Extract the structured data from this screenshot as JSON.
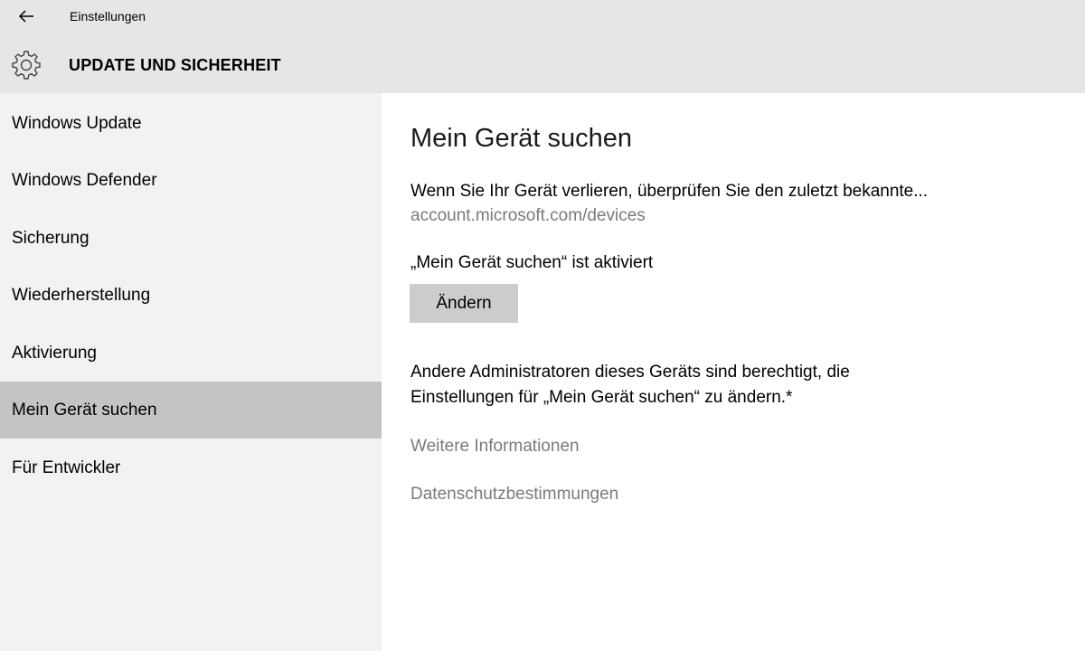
{
  "titlebar": {
    "back_icon": "back-arrow-icon",
    "title": "Einstellungen"
  },
  "header": {
    "icon": "gear-icon",
    "title": "UPDATE UND SICHERHEIT"
  },
  "sidebar": {
    "items": [
      {
        "label": "Windows Update"
      },
      {
        "label": "Windows Defender"
      },
      {
        "label": "Sicherung"
      },
      {
        "label": "Wiederherstellung"
      },
      {
        "label": "Aktivierung"
      },
      {
        "label": "Mein Gerät suchen",
        "selected": true
      },
      {
        "label": "Für Entwickler"
      }
    ]
  },
  "content": {
    "title": "Mein Gerät suchen",
    "description": "Wenn Sie Ihr Gerät verlieren, überprüfen Sie den zuletzt bekannte...",
    "devices_link": "account.microsoft.com/devices",
    "status": "„Mein Gerät suchen“ ist aktiviert",
    "change_button": "Ändern",
    "info_line1": "Andere Administratoren dieses Geräts sind berechtigt, die",
    "info_line2": "Einstellungen für „Mein Gerät suchen“ zu ändern.*",
    "more_info_link": "Weitere Informationen",
    "privacy_link": "Datenschutzbestimmungen"
  },
  "colors": {
    "header_bg": "#e6e6e6",
    "sidebar_bg": "#f2f2f2",
    "selected_bg": "#c4c4c4",
    "button_bg": "#cccccc",
    "link_gray": "#7a7a7a"
  }
}
